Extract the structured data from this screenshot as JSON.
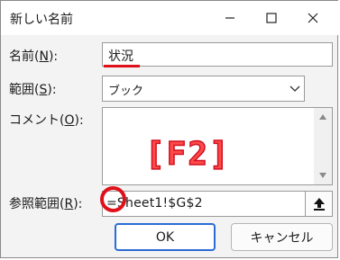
{
  "window": {
    "title": "新しい名前",
    "minimize": "minimize",
    "maximize": "maximize",
    "close": "close"
  },
  "fields": {
    "name_label_pre": "名前(",
    "name_label_key": "N",
    "name_label_post": "):",
    "name_value": "状況",
    "scope_label_pre": "範囲(",
    "scope_label_key": "S",
    "scope_label_post": "):",
    "scope_value": "ブック",
    "comment_label_pre": "コメント(",
    "comment_label_key": "O",
    "comment_label_post": "):",
    "comment_value": "",
    "refers_label_pre": "参照範囲(",
    "refers_label_key": "R",
    "refers_label_post": "):",
    "refers_value": "=Sheet1!$G$2"
  },
  "annotation": {
    "key_hint": "[F2]",
    "accent_color": "#e0101a"
  },
  "buttons": {
    "ok": "OK",
    "cancel": "キャンセル"
  }
}
